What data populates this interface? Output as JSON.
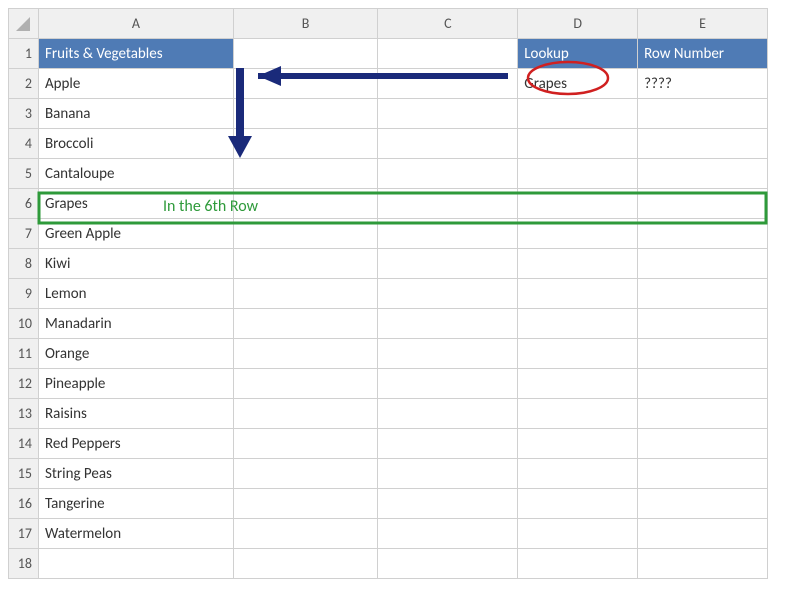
{
  "columns": [
    "A",
    "B",
    "C",
    "D",
    "E"
  ],
  "rowCount": 18,
  "headers": {
    "A1": "Fruits & Vegetables",
    "D1": "Lookup",
    "E1": "Row Number"
  },
  "lookup": {
    "value": "Grapes",
    "result": "????"
  },
  "items": [
    "Apple",
    "Banana",
    "Broccoli",
    "Cantaloupe",
    "Grapes",
    "Green Apple",
    "Kiwi",
    "Lemon",
    "Manadarin",
    "Orange",
    "Pineapple",
    "Raisins",
    "Red Peppers",
    "String Peas",
    "Tangerine",
    "Watermelon"
  ],
  "annotation": {
    "highlight_text": "In the 6th Row"
  },
  "colors": {
    "header_bg": "#4f7bb5",
    "arrow": "#1a2a7a",
    "highlight_border": "#2e9a3a",
    "circle": "#d02020"
  }
}
